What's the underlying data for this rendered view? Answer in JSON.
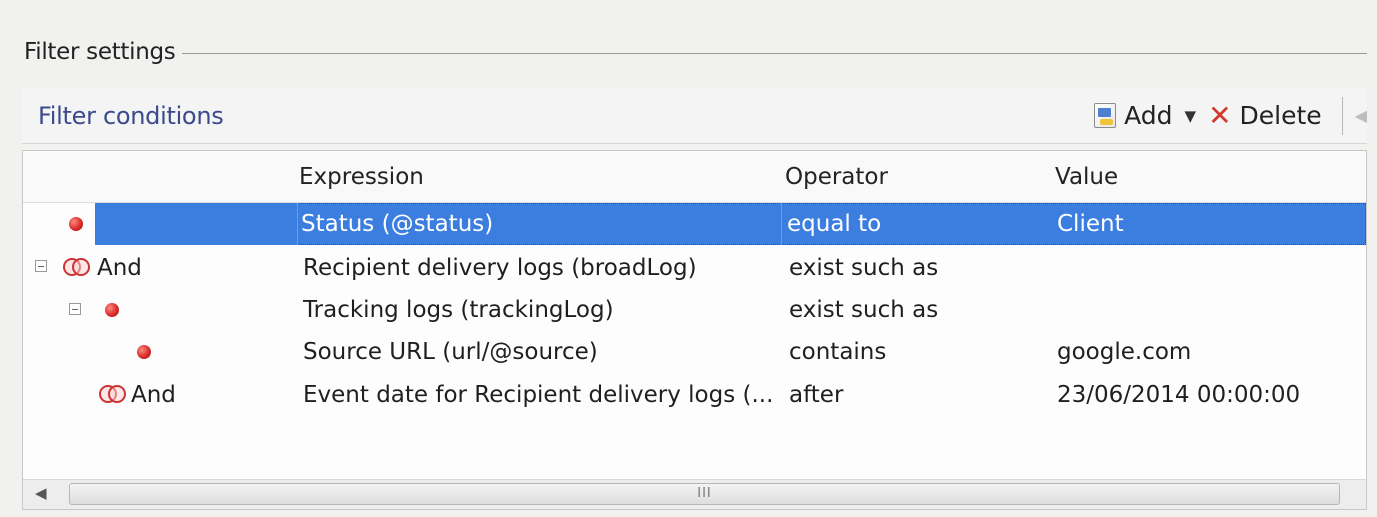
{
  "group": {
    "title": "Filter settings"
  },
  "conditions": {
    "title": "Filter conditions",
    "toolbar": {
      "add_label": "Add",
      "delete_label": "Delete"
    }
  },
  "columns": {
    "expression": "Expression",
    "operator": "Operator",
    "value": "Value"
  },
  "rows": [
    {
      "logic": "",
      "expression": "Status (@status)",
      "operator": "equal to",
      "value": "Client",
      "selected": true
    },
    {
      "logic": "And",
      "expression": "Recipient delivery logs (broadLog)",
      "operator": "exist such as",
      "value": ""
    },
    {
      "logic": "",
      "expression": "Tracking logs (trackingLog)",
      "operator": "exist such as",
      "value": ""
    },
    {
      "logic": "",
      "expression": "Source URL (url/@source)",
      "operator": "contains",
      "value": "google.com"
    },
    {
      "logic": "And",
      "expression": "Event date for Recipient delivery logs (...",
      "operator": "after",
      "value": "23/06/2014 00:00:00"
    }
  ],
  "scrollbar": {
    "grip": "III"
  },
  "colors": {
    "selection": "#3b7ee0",
    "title_blue": "#3a4a8c",
    "delete_red": "#d0392b",
    "condition_dot": "#d92c2c"
  }
}
